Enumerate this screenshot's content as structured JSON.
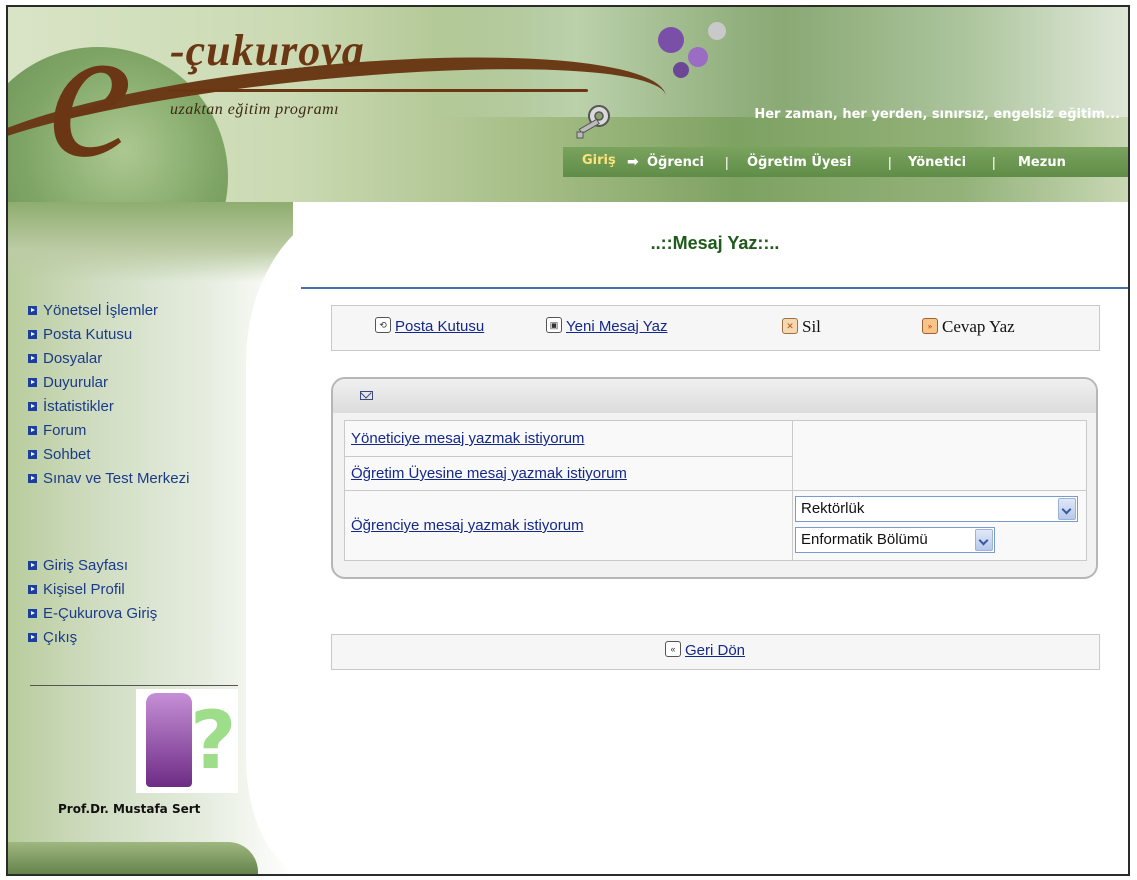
{
  "header": {
    "brand": "-çukurova",
    "brand_subtitle": "uzaktan eğitim programı",
    "slogan": "Her zaman, her yerden, sınırsız, engelsiz eğitim...",
    "nav": {
      "giris": "Giriş",
      "items": [
        "Öğrenci",
        "Öğretim Üyesi",
        "Yönetici",
        "Mezun"
      ]
    }
  },
  "sidebar": {
    "menu1": [
      "Yönetsel İşlemler",
      "Posta Kutusu",
      "Dosyalar",
      "Duyurular",
      "İstatistikler",
      "Forum",
      "Sohbet",
      "Sınav ve Test Merkezi"
    ],
    "menu2": [
      "Giriş Sayfası",
      "Kişisel Profil",
      "E-Çukurova Giriş",
      "Çıkış"
    ],
    "profile_name": "Prof.Dr. Mustafa Sert"
  },
  "main": {
    "title": "..::Mesaj Yaz::..",
    "toolbar": {
      "inbox": "Posta Kutusu",
      "new_message": "Yeni Mesaj Yaz",
      "delete": "Sil",
      "reply": "Cevap Yaz"
    },
    "options": {
      "to_admin": "Yöneticiye mesaj yazmak istiyorum",
      "to_faculty": "Öğretim Üyesine mesaj yazmak istiyorum",
      "to_student": "Öğrenciye mesaj yazmak istiyorum"
    },
    "selects": {
      "unit": "Rektörlük",
      "department": "Enformatik Bölümü"
    },
    "back": "Geri Dön"
  },
  "colors": {
    "link": "#14288a",
    "title": "#1e5a1a",
    "brand_brown": "#6a3613",
    "menu_bullet": "#1c3ea0"
  }
}
